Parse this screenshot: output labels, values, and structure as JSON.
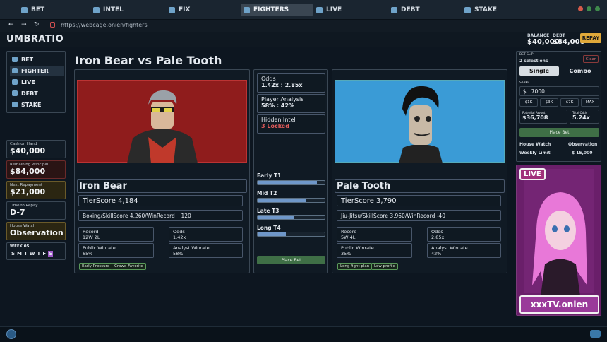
{
  "tabs": [
    {
      "label": "BET",
      "color": "#6fa3c9"
    },
    {
      "label": "INTEL",
      "color": "#6fa3c9"
    },
    {
      "label": "FIX",
      "color": "#6fa3c9"
    },
    {
      "label": "FIGHTERS",
      "color": "#6fa3c9"
    },
    {
      "label": "LIVE",
      "color": "#6fa3c9"
    },
    {
      "label": "DEBT",
      "color": "#6fa3c9"
    },
    {
      "label": "STAKE",
      "color": "#6fa3c9"
    }
  ],
  "url": "https://webcage.onien/fighters",
  "brand": "UMBRATIO",
  "balance": {
    "label": "BALANCE",
    "value": "$40,000"
  },
  "debt": {
    "label": "DEBT",
    "value": "$84,000"
  },
  "repay_label": "REPAY",
  "sidebar": {
    "items": [
      "BET",
      "FIGHTER",
      "LIVE",
      "DEBT",
      "STAKE"
    ]
  },
  "stats": [
    {
      "label": "Cash on Hand",
      "value": "$40,000",
      "bg": "#111b25",
      "border": "#3a4754"
    },
    {
      "label": "Remaining Principal",
      "value": "$84,000",
      "bg": "#2a1414",
      "border": "#6a2a2a"
    },
    {
      "label": "Next Repayment",
      "value": "$21,000",
      "bg": "#2b2612",
      "border": "#6a5a2a"
    },
    {
      "label": "Time to Repay",
      "value": "D-7",
      "bg": "#111b25",
      "border": "#3a4754"
    },
    {
      "label": "House Watch",
      "value": "Observation",
      "bg": "#2b2612",
      "border": "#6a5a2a"
    }
  ],
  "week": {
    "label": "WEEK 05",
    "days": [
      "S",
      "M",
      "T",
      "W",
      "T",
      "F",
      "S"
    ]
  },
  "match_title": "Iron Bear vs Pale Tooth",
  "fighter_a": {
    "name": "Iron Bear",
    "tierscore": "TierScore 4,184",
    "style": "Boxing/SkillScore 4,260/WinRecord +120",
    "record_label": "Record",
    "record": "12W 2L",
    "odds_label": "Odds",
    "odds": "1.42x",
    "public_label": "Public Winrate",
    "public": "65%",
    "analyst_label": "Analyst Winrate",
    "analyst": "58%",
    "tags": [
      "Early Pressure",
      "Crowd Favorite"
    ]
  },
  "fighter_b": {
    "name": "Pale Tooth",
    "tierscore": "TierScore 3,790",
    "style": "Jiu-Jitsu/SkillScore 3,960/WinRecord -40",
    "record_label": "Record",
    "record": "5W 4L",
    "odds_label": "Odds",
    "odds": "2.85x",
    "public_label": "Public Winrate",
    "public": "35%",
    "analyst_label": "Analyst Winrate",
    "analyst": "42%",
    "tags": [
      "Long fight plan",
      "Low profile"
    ]
  },
  "center": {
    "odds_label": "Odds",
    "odds": "1.42x : 2.85x",
    "analysis_label": "Player Analysis",
    "analysis": "58% : 42%",
    "intel_label": "Hidden Intel",
    "intel": "3 Locked",
    "phases": [
      {
        "label": "Early T1",
        "fill": 0.88
      },
      {
        "label": "Mid T2",
        "fill": 0.72
      },
      {
        "label": "Late T3",
        "fill": 0.55
      },
      {
        "label": "Long T4",
        "fill": 0.42
      }
    ],
    "place_bet": "Place Bet"
  },
  "betslip": {
    "header": "BET SLIP",
    "selections": "2 selections",
    "clear": "Clear",
    "single": "Single",
    "combo": "Combo",
    "stake_label": "STAKE",
    "stake_value": "7000",
    "currency": "$",
    "quick": [
      "$1K",
      "$3K",
      "$7K",
      "MAX"
    ],
    "payout_label": "Potential Payout",
    "payout": "$36,708",
    "total_odds_label": "Total Odds",
    "total_odds": "5.24x",
    "place_bet": "Place Bet",
    "house_watch_label": "House Watch",
    "house_watch": "Observation",
    "weekly_limit_label": "Weekly Limit",
    "weekly_limit": "$ 15,000"
  },
  "stream": {
    "live": "LIVE",
    "channel": "xxxTV.onien"
  }
}
